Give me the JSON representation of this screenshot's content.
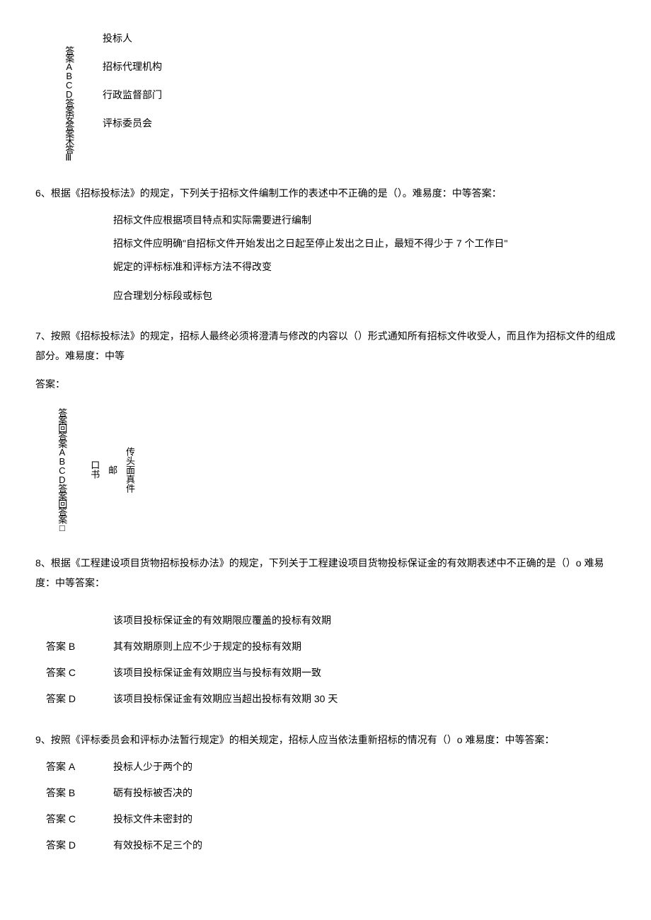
{
  "q5": {
    "vertical_label": "答案ABCD答案安答案木答Ⅲ",
    "options": {
      "a": "投标人",
      "b": "招标代理机构",
      "c": "行政监督部门",
      "d": "评标委员会"
    }
  },
  "q6": {
    "text": "6、根据《招标投标法》的规定，下列关于招标文件编制工作的表述中不正确的是（）。难易度：中等答案：",
    "options": {
      "a": "招标文件应根据项目特点和实际需要进行编制",
      "b": "招标文件应明确\"自招标文件开始发出之日起至停止发出之日止，最短不得少于 7 个工作日\"",
      "c": "妮定的评标标准和评标方法不得改变",
      "d": "应合理划分标段或标包"
    }
  },
  "q7": {
    "text": "7、按照《招标投标法》的规定，招标人最终必须将澄清与修改的内容以（）形式通知所有招标文件收受人，而且作为招标文件的组成部分。难易度：中等",
    "answer_label": "答案：",
    "vertical_left": "答案回答案ABCD答案回答案□",
    "vertical_right_1": "传头面真",
    "vertical_right_2": "件",
    "vertical_right_3": "邮",
    "vertical_right_4": "口书"
  },
  "q8": {
    "text": "8、根据《工程建设项目货物招标投标办法》的规定，下列关于工程建设项目货物投标保证金的有效期表述中不正确的是（）o 难易度：中等答案：",
    "options": {
      "a_content": "该项目投标保证金的有效期限应覆盖的投标有效期",
      "b_label": "答案 B",
      "b_content": "其有效期原则上应不少于规定的投标有效期",
      "c_label": "答案 C",
      "c_content": "该项目投标保证金有效期应当与投标有效期一致",
      "d_label": "答案 D",
      "d_content": "该项目投标保证金有效期应当超出投标有效期 30 天"
    }
  },
  "q9": {
    "text": "9、按照《评标委员会和评标办法暂行规定》的相关规定，招标人应当依法重新招标的情况有（）o 难易度：中等答案：",
    "options": {
      "a_label": "答案 A",
      "a_content": "投标人少于两个的",
      "b_label": "答案 B",
      "b_content": "砺有投标被否决的",
      "c_label": "答案 C",
      "c_content": "投标文件未密封的",
      "d_label": "答案 D",
      "d_content": "有效投标不足三个的"
    }
  }
}
